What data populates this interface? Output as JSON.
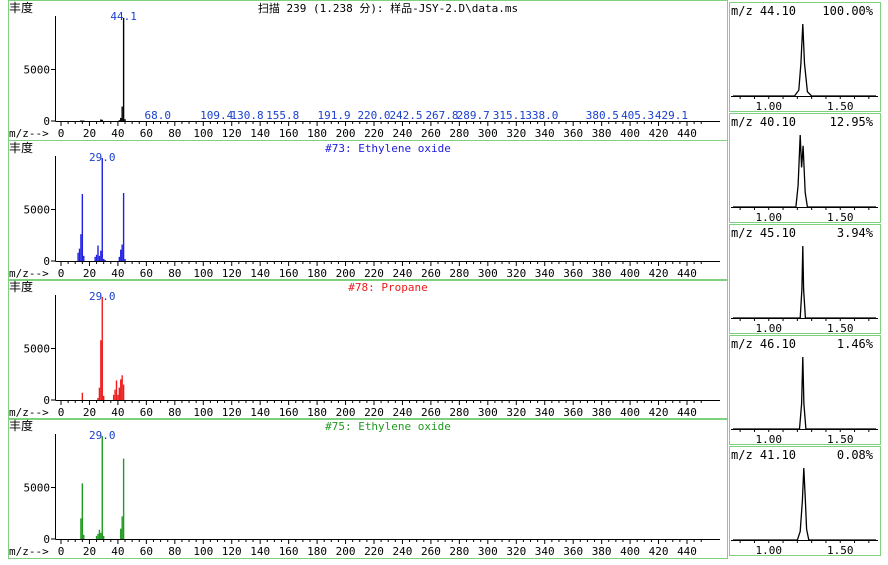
{
  "labels": {
    "ylabel": "丰度",
    "xlabel": "m/z-->",
    "rt_ticks": [
      "1.00",
      "1.50"
    ]
  },
  "colors": {
    "main": "#000000",
    "lib1": "#2020e0",
    "lib2": "#ee1c1c",
    "lib3": "#1f9a1f",
    "frame": "#7fd07f",
    "peak_label": "#1a3fd0"
  },
  "chart_data": [
    {
      "type": "bar",
      "title": "扫描 239 (1.238 分): 样品-JSY-2.D\\data.ms",
      "title_color": "#000000",
      "color": "#000000",
      "xlim": [
        0,
        450
      ],
      "xticks": [
        0,
        20,
        40,
        60,
        80,
        100,
        120,
        140,
        160,
        180,
        200,
        220,
        240,
        260,
        280,
        300,
        320,
        340,
        360,
        380,
        400,
        420,
        440
      ],
      "ylim": [
        0,
        10000
      ],
      "yticks": [
        0,
        5000
      ],
      "x": [
        14,
        15,
        16,
        28,
        29,
        41,
        42,
        43,
        44,
        45
      ],
      "y": [
        60,
        40,
        50,
        150,
        120,
        80,
        300,
        1400,
        10000,
        180
      ],
      "peak_labels": [
        {
          "x": 44,
          "y": 10000,
          "text": "44.1",
          "ypx": 20
        },
        {
          "x": 68,
          "text": "68.0"
        },
        {
          "x": 109.4,
          "text": "109.4"
        },
        {
          "x": 130.8,
          "text": "130.8"
        },
        {
          "x": 155.8,
          "text": "155.8"
        },
        {
          "x": 191.9,
          "text": "191.9"
        },
        {
          "x": 220.0,
          "text": "220.0"
        },
        {
          "x": 242.5,
          "text": "242.5"
        },
        {
          "x": 267.8,
          "text": "267.8"
        },
        {
          "x": 289.7,
          "text": "289.7"
        },
        {
          "x": 315.1,
          "text": "315.1"
        },
        {
          "x": 338.0,
          "text": "338.0"
        },
        {
          "x": 380.5,
          "text": "380.5"
        },
        {
          "x": 405.3,
          "text": "405.3"
        },
        {
          "x": 429.1,
          "text": "429.1"
        }
      ]
    },
    {
      "type": "bar",
      "title": "#73: Ethylene oxide",
      "title_color": "#2020e0",
      "color": "#2020e0",
      "xlim": [
        0,
        450
      ],
      "xticks": [
        0,
        20,
        40,
        60,
        80,
        100,
        120,
        140,
        160,
        180,
        200,
        220,
        240,
        260,
        280,
        300,
        320,
        340,
        360,
        380,
        400,
        420,
        440
      ],
      "ylim": [
        0,
        10000
      ],
      "yticks": [
        0,
        5000
      ],
      "x": [
        12,
        13,
        14,
        15,
        16,
        24,
        25,
        26,
        27,
        28,
        29,
        30,
        31,
        41,
        42,
        43,
        44,
        45
      ],
      "y": [
        800,
        1200,
        2600,
        6500,
        500,
        400,
        600,
        1500,
        500,
        1000,
        10000,
        200,
        100,
        400,
        1100,
        1600,
        6600,
        200
      ],
      "peak_labels": [
        {
          "x": 29,
          "y": 10000,
          "text": "29.0"
        }
      ]
    },
    {
      "type": "bar",
      "title": "#78: Propane",
      "title_color": "#ee1c1c",
      "color": "#ee1c1c",
      "xlim": [
        0,
        450
      ],
      "xticks": [
        0,
        20,
        40,
        60,
        80,
        100,
        120,
        140,
        160,
        180,
        200,
        220,
        240,
        260,
        280,
        300,
        320,
        340,
        360,
        380,
        400,
        420,
        440
      ],
      "ylim": [
        0,
        10000
      ],
      "yticks": [
        0,
        5000
      ],
      "x": [
        15,
        26,
        27,
        28,
        29,
        30,
        37,
        38,
        39,
        40,
        41,
        42,
        43,
        44
      ],
      "y": [
        700,
        200,
        1200,
        5800,
        10000,
        400,
        500,
        1000,
        1900,
        500,
        1200,
        2000,
        2400,
        1500
      ],
      "peak_labels": [
        {
          "x": 29,
          "y": 10000,
          "text": "29.0"
        }
      ]
    },
    {
      "type": "bar",
      "title": "#75: Ethylene oxide",
      "title_color": "#1f9a1f",
      "color": "#1f9a1f",
      "xlim": [
        0,
        450
      ],
      "xticks": [
        0,
        20,
        40,
        60,
        80,
        100,
        120,
        140,
        160,
        180,
        200,
        220,
        240,
        260,
        280,
        300,
        320,
        340,
        360,
        380,
        400,
        420,
        440
      ],
      "ylim": [
        0,
        10000
      ],
      "yticks": [
        0,
        5000
      ],
      "x": [
        14,
        15,
        16,
        25,
        26,
        27,
        28,
        29,
        30,
        42,
        43,
        44
      ],
      "y": [
        2000,
        5400,
        400,
        300,
        500,
        900,
        600,
        10000,
        300,
        1000,
        2200,
        7800
      ],
      "peak_labels": [
        {
          "x": 29,
          "y": 10000,
          "text": "29.0"
        }
      ]
    }
  ],
  "ion_traces": [
    {
      "type": "line",
      "title": "m/z  44.10",
      "percent": "100.00%",
      "xlim": [
        0.75,
        1.75
      ],
      "x": [
        0.75,
        1.18,
        1.21,
        1.225,
        1.238,
        1.25,
        1.27,
        1.3,
        1.75
      ],
      "y": [
        0,
        0,
        0.08,
        0.45,
        1.0,
        0.45,
        0.06,
        0,
        0
      ]
    },
    {
      "type": "line",
      "title": "m/z  40.10",
      "percent": "12.95%",
      "xlim": [
        0.75,
        1.75
      ],
      "x": [
        0.75,
        1.19,
        1.205,
        1.22,
        1.23,
        1.24,
        1.255,
        1.27,
        1.75
      ],
      "y": [
        0,
        0,
        0.3,
        1.0,
        0.55,
        0.85,
        0.2,
        0,
        0
      ]
    },
    {
      "type": "line",
      "title": "m/z  45.10",
      "percent": "3.94%",
      "xlim": [
        0.75,
        1.75
      ],
      "x": [
        0.75,
        1.22,
        1.232,
        1.238,
        1.244,
        1.256,
        1.75
      ],
      "y": [
        0,
        0,
        0.4,
        1.0,
        0.4,
        0,
        0
      ]
    },
    {
      "type": "line",
      "title": "m/z  46.10",
      "percent": "1.46%",
      "xlim": [
        0.75,
        1.75
      ],
      "x": [
        0.75,
        1.215,
        1.23,
        1.238,
        1.246,
        1.26,
        1.75
      ],
      "y": [
        0,
        0,
        0.35,
        1.0,
        0.35,
        0,
        0
      ]
    },
    {
      "type": "line",
      "title": "m/z  41.10",
      "percent": "0.08%",
      "xlim": [
        0.75,
        1.75
      ],
      "x": [
        0.75,
        1.2,
        1.22,
        1.235,
        1.245,
        1.255,
        1.265,
        1.28,
        1.75
      ],
      "y": [
        0,
        0,
        0.12,
        0.55,
        1.0,
        0.6,
        0.15,
        0,
        0
      ]
    }
  ]
}
